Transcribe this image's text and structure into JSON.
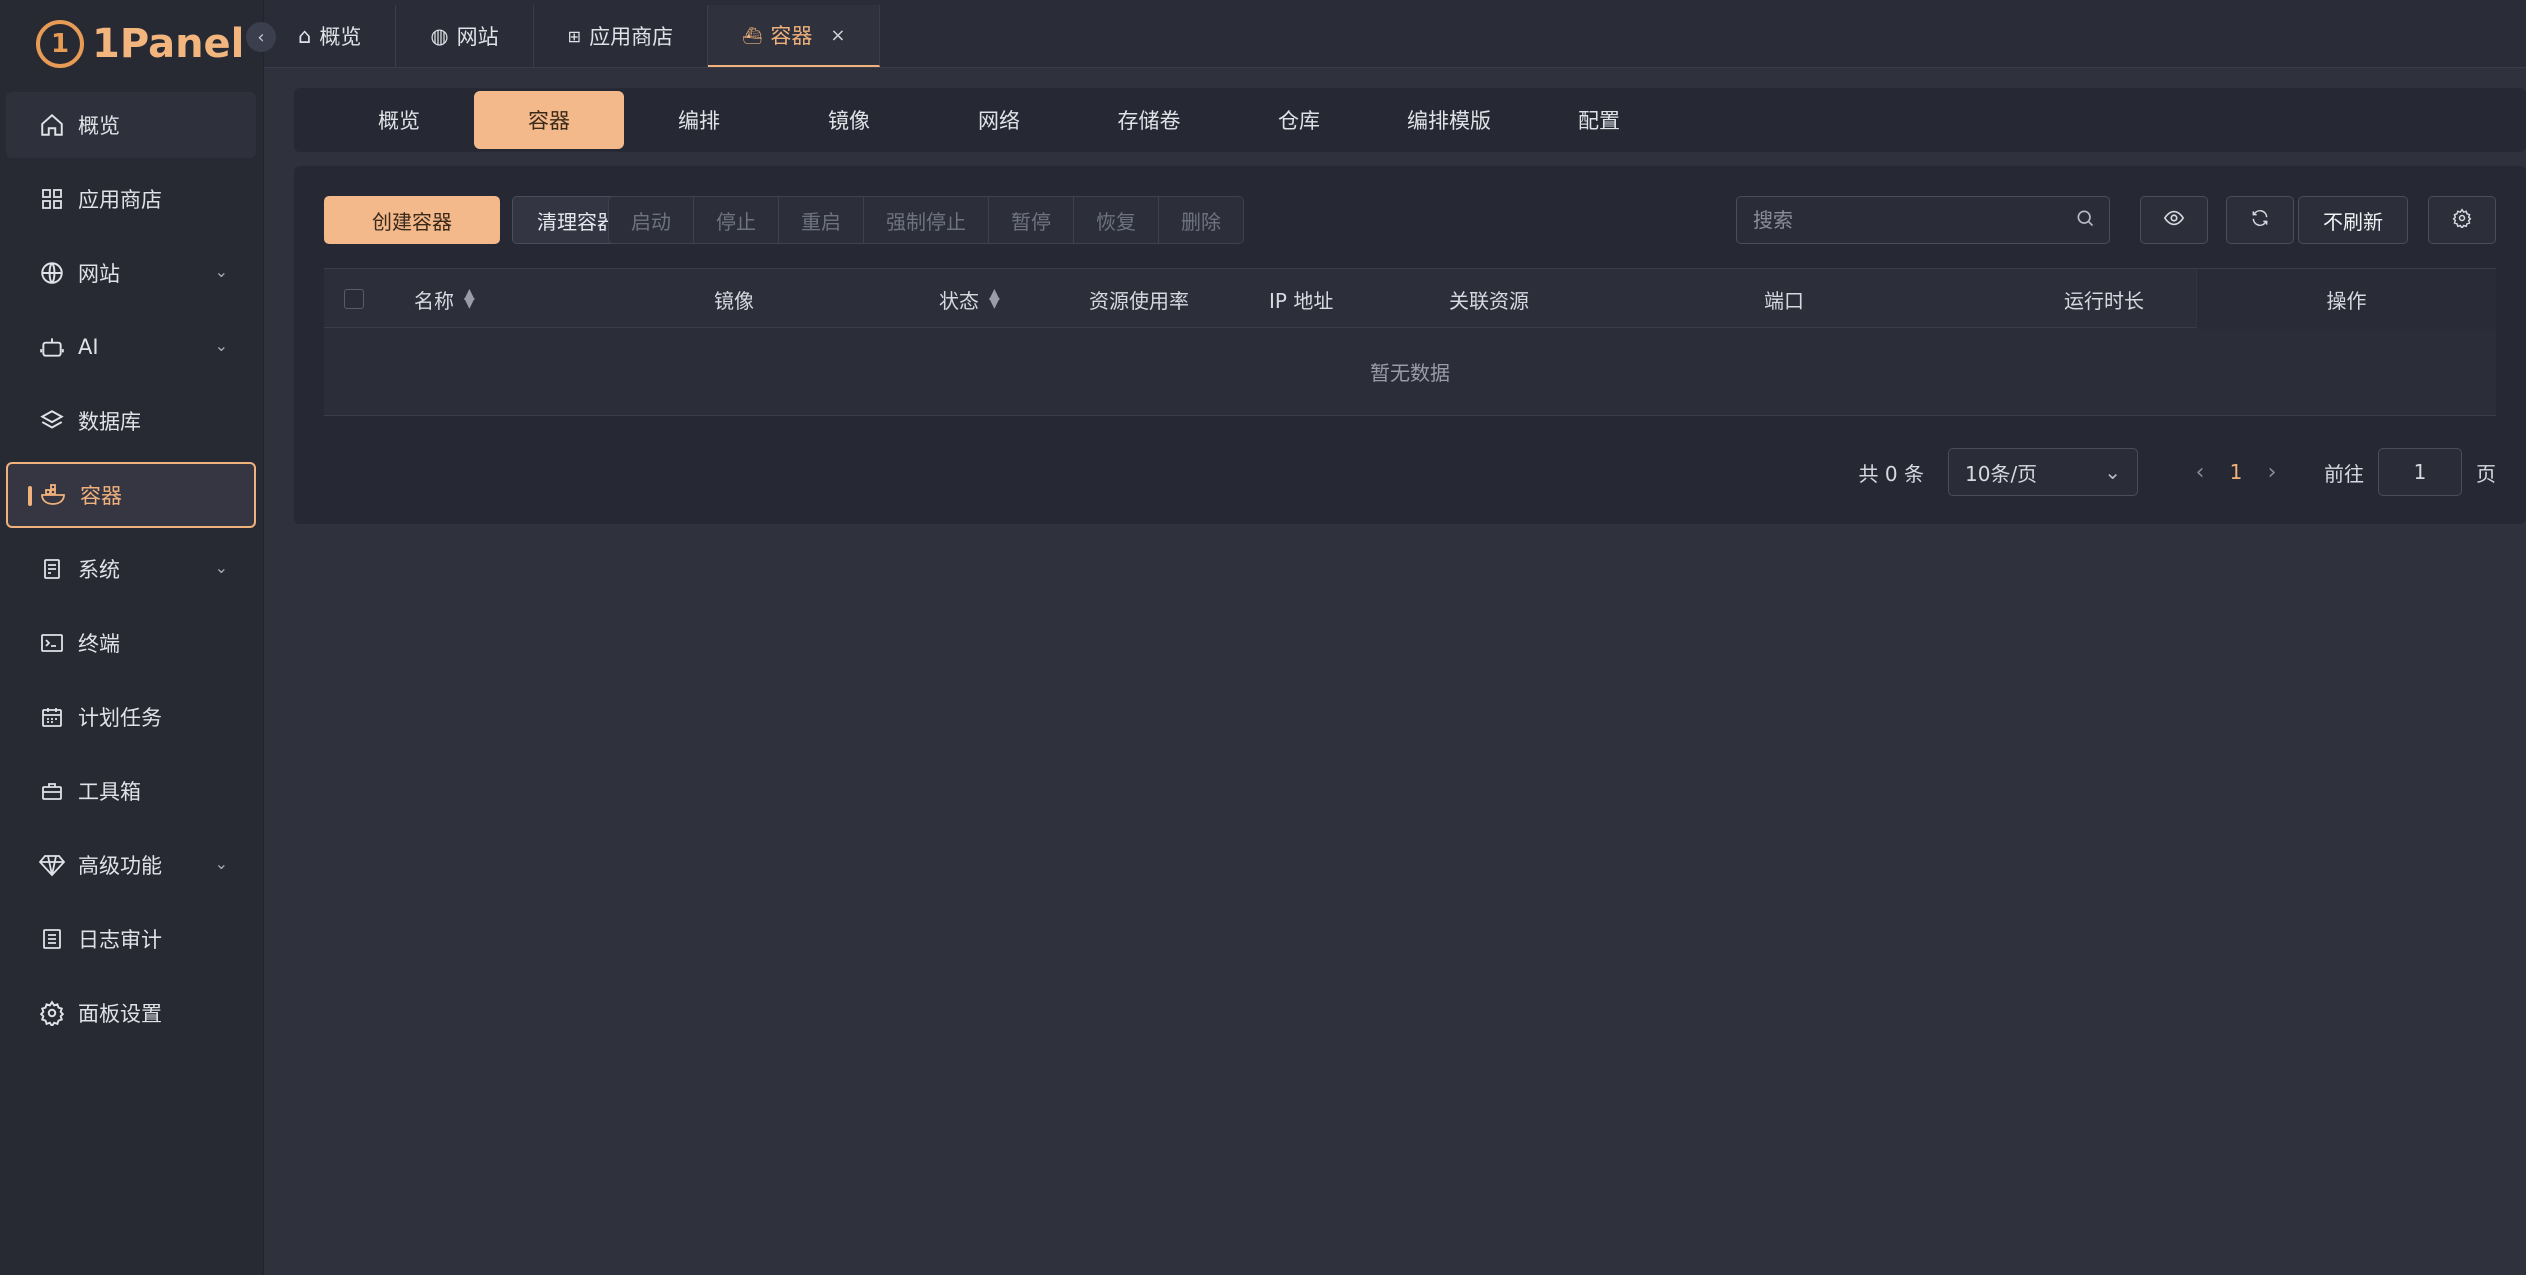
{
  "app": {
    "logo_text": "1Panel",
    "logo_mark": "1"
  },
  "sidebar": {
    "items": [
      {
        "label": "概览",
        "icon": "home-icon"
      },
      {
        "label": "应用商店",
        "icon": "grid-icon"
      },
      {
        "label": "网站",
        "icon": "globe-icon",
        "expandable": true
      },
      {
        "label": "AI",
        "icon": "robot-icon",
        "expandable": true
      },
      {
        "label": "数据库",
        "icon": "layers-icon"
      },
      {
        "label": "容器",
        "icon": "docker-icon",
        "active": true
      },
      {
        "label": "系统",
        "icon": "server-icon",
        "expandable": true
      },
      {
        "label": "终端",
        "icon": "terminal-icon"
      },
      {
        "label": "计划任务",
        "icon": "calendar-icon"
      },
      {
        "label": "工具箱",
        "icon": "toolbox-icon"
      },
      {
        "label": "高级功能",
        "icon": "diamond-icon",
        "expandable": true
      },
      {
        "label": "日志审计",
        "icon": "log-icon"
      },
      {
        "label": "面板设置",
        "icon": "gear-icon"
      }
    ]
  },
  "top_tabs": [
    {
      "label": "概览",
      "icon": "home-icon"
    },
    {
      "label": "网站",
      "icon": "globe-icon"
    },
    {
      "label": "应用商店",
      "icon": "grid-icon"
    },
    {
      "label": "容器",
      "icon": "docker-icon",
      "active": true,
      "close": "×"
    }
  ],
  "sub_tabs": [
    "概览",
    "容器",
    "编排",
    "镜像",
    "网络",
    "存储卷",
    "仓库",
    "编排模版",
    "配置"
  ],
  "sub_tab_active": "容器",
  "toolbar": {
    "create_label": "创建容器",
    "clean_label": "清理容器",
    "group": [
      "启动",
      "停止",
      "重启",
      "强制停止",
      "暂停",
      "恢复",
      "删除"
    ],
    "search_placeholder": "搜索",
    "refresh_mode_label": "不刷新"
  },
  "table": {
    "columns": {
      "name": "名称",
      "image": "镜像",
      "status": "状态",
      "resource": "资源使用率",
      "ip": "IP 地址",
      "related": "关联资源",
      "port": "端口",
      "uptime": "运行时长",
      "ops": "操作"
    },
    "empty_text": "暂无数据"
  },
  "pagination": {
    "total_text": "共 0 条",
    "page_size": "10条/页",
    "current_page": "1",
    "goto_label": "前往",
    "goto_value": "1",
    "page_suffix": "页"
  },
  "colors": {
    "accent": "#f0b27c",
    "primary_button": "#f4b98a",
    "background": "#2f313d",
    "sidebar": "#272933"
  }
}
